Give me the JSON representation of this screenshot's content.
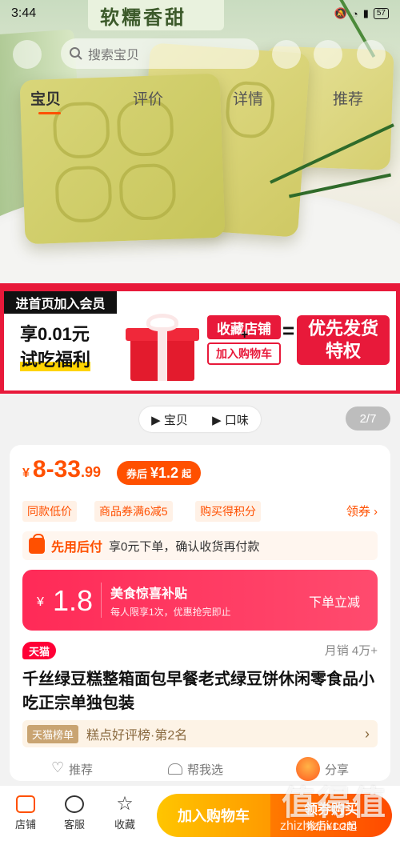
{
  "status_bar": {
    "time": "3:44",
    "battery": "57"
  },
  "hero": {
    "banner_text": "软糯香甜"
  },
  "search": {
    "placeholder": "搜索宝贝"
  },
  "tabs": [
    {
      "label": "宝贝"
    },
    {
      "label": "评价"
    },
    {
      "label": "详情"
    },
    {
      "label": "推荐"
    }
  ],
  "promo": {
    "join_label": "进首页加入会员",
    "line1": "享0.01元",
    "line2": "试吃福利",
    "follow_store": "收藏店铺",
    "plus": "+",
    "add_cart": "加入购物车",
    "equals": "=",
    "privilege_line1": "优先发货",
    "privilege_line2": "特权"
  },
  "selector": {
    "item1": "▶ 宝贝",
    "item2": "▶ 口味"
  },
  "gallery_counter": "2/7",
  "price": {
    "currency": "¥",
    "main": "8-33",
    "decimal": ".99",
    "coupon_label": "券后",
    "coupon_value": "¥1.2",
    "coupon_suffix": "起"
  },
  "tags": [
    "同款低价",
    "商品券满6减5",
    "购买得积分"
  ],
  "coupon_link": "领券 ›",
  "paylater": {
    "title": "先用后付",
    "desc": "享0元下单，确认收货再付款"
  },
  "subsidy": {
    "currency": "¥",
    "amount": "1.8",
    "title": "美食惊喜补贴",
    "desc": "每人限享1次，优惠抢完即止",
    "cta": "下单立减"
  },
  "badge_tmall": "天猫",
  "sales": "月销 4万+",
  "product_title": "千丝绿豆糕整箱面包早餐老式绿豆饼休闲零食品小吃正宗单独包装",
  "rank": {
    "badge": "天猫榜单",
    "text": "糕点好评榜·第2名",
    "arrow": "›"
  },
  "actions": {
    "recommend": "推荐",
    "help_choose": "帮我选",
    "share": "分享"
  },
  "bottom_bar": {
    "store": "店铺",
    "service": "客服",
    "favorite": "收藏",
    "add_cart": "加入购物车",
    "buy_line1": "领券购买",
    "buy_line2": "券后¥1.2起"
  },
  "watermark": {
    "text": "值得值",
    "url": "zhizhizhi.com"
  },
  "colors": {
    "accent": "#ff5000",
    "promo_red": "#e8193a",
    "subsidy_pink": "#ff2a57"
  }
}
